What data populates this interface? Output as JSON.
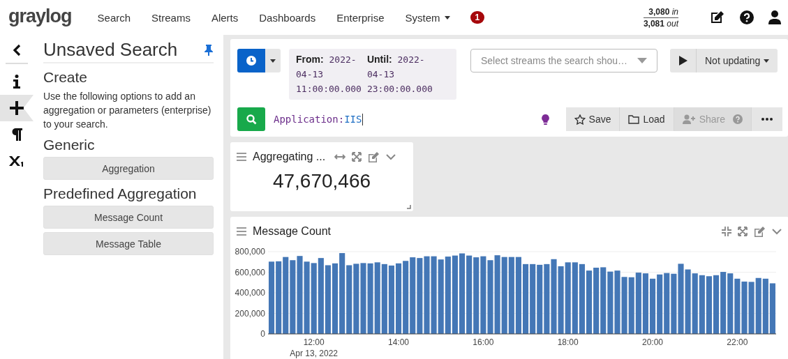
{
  "nav": {
    "logo": "graylog",
    "items": [
      {
        "label": "Search",
        "has_caret": false
      },
      {
        "label": "Streams",
        "has_caret": false
      },
      {
        "label": "Alerts",
        "has_caret": false
      },
      {
        "label": "Dashboards",
        "has_caret": false
      },
      {
        "label": "Enterprise",
        "has_caret": false
      },
      {
        "label": "System",
        "has_caret": true
      }
    ],
    "notification_count": "1",
    "throughput": {
      "in_value": "3,080",
      "in_unit": "in",
      "out_value": "3,081",
      "out_unit": "out"
    }
  },
  "rail": [
    {
      "kind": "back",
      "selected": false
    },
    {
      "kind": "info",
      "selected": false
    },
    {
      "kind": "create",
      "selected": true
    },
    {
      "kind": "pilcrow",
      "selected": false
    },
    {
      "kind": "parameters",
      "selected": false
    }
  ],
  "sidebar": {
    "title": "Unsaved Search",
    "pinned": true,
    "heading": "Create",
    "description": "Use the following options to add an aggregation or parameters (enterprise) to your search.",
    "sections": [
      {
        "title": "Generic",
        "buttons": [
          "Aggregation"
        ]
      },
      {
        "title": "Predefined Aggregation",
        "buttons": [
          "Message Count",
          "Message Table"
        ]
      }
    ]
  },
  "search": {
    "range": [
      {
        "label": "From:",
        "lines": [
          "2022-",
          "04-13",
          "11:00:00.000"
        ]
      },
      {
        "label": "Until:",
        "lines": [
          "2022-",
          "04-13",
          "23:00:00.000"
        ]
      }
    ],
    "streams_placeholder": "Select streams the search shou…",
    "refresh": "Not updating",
    "query_field": "Application:",
    "query_value": "IIS",
    "actions": [
      {
        "kind": "save",
        "label": "Save",
        "disabled": false
      },
      {
        "kind": "load",
        "label": "Load",
        "disabled": false
      },
      {
        "kind": "share",
        "label": "Share",
        "disabled": true
      },
      {
        "kind": "more"
      }
    ]
  },
  "widgets": [
    {
      "kind": "number",
      "title": "Aggregating ...",
      "value": "47,670,466"
    },
    {
      "kind": "chart",
      "title": "Message Count",
      "chart_data": {
        "type": "bar",
        "grid": true,
        "xlim": [
          10.917,
          22.917
        ],
        "x": [
          11,
          11.167,
          11.333,
          11.5,
          11.667,
          11.833,
          12,
          12.167,
          12.333,
          12.5,
          12.667,
          12.833,
          13,
          13.167,
          13.333,
          13.5,
          13.667,
          13.833,
          14,
          14.167,
          14.333,
          14.5,
          14.667,
          14.833,
          15,
          15.167,
          15.333,
          15.5,
          15.667,
          15.833,
          16,
          16.167,
          16.333,
          16.5,
          16.667,
          16.833,
          17,
          17.167,
          17.333,
          17.5,
          17.667,
          17.833,
          18,
          18.167,
          18.333,
          18.5,
          18.667,
          18.833,
          19,
          19.167,
          19.333,
          19.5,
          19.667,
          19.833,
          20,
          20.167,
          20.333,
          20.5,
          20.667,
          20.833,
          21,
          21.167,
          21.333,
          21.5,
          21.667,
          21.833,
          22,
          22.167,
          22.333,
          22.5,
          22.667,
          22.833
        ],
        "series": [
          {
            "color": "#4477b6",
            "values": [
              703000,
              706000,
              748000,
              717000,
              758000,
              703000,
              689000,
              738000,
              668000,
              686000,
              786000,
              668000,
              682000,
              689000,
              686000,
              696000,
              679000,
              665000,
              686000,
              710000,
              745000,
              738000,
              755000,
              755000,
              724000,
              752000,
              762000,
              783000,
              762000,
              745000,
              755000,
              717000,
              765000,
              748000,
              748000,
              748000,
              679000,
              679000,
              672000,
              679000,
              727000,
              658000,
              696000,
              696000,
              679000,
              616000,
              644000,
              648000,
              606000,
              616000,
              554000,
              551000,
              596000,
              589000,
              537000,
              578000,
              592000,
              585000,
              682000,
              627000,
              589000,
              571000,
              561000,
              571000,
              603000,
              589000,
              537000,
              509000,
              506000,
              544000,
              537000,
              492000
            ]
          }
        ],
        "ylim": [
          0,
          800000
        ],
        "yticks": [
          {
            "value": 0,
            "label": "0"
          },
          {
            "value": 200000,
            "label": "200,000"
          },
          {
            "value": 400000,
            "label": "400,000"
          },
          {
            "value": 600000,
            "label": "600,000"
          },
          {
            "value": 800000,
            "label": "800,000"
          }
        ],
        "xticks": [
          {
            "value": 12,
            "label": "12:00"
          },
          {
            "value": 14,
            "label": "14:00"
          },
          {
            "value": 16,
            "label": "16:00"
          },
          {
            "value": 18,
            "label": "18:00"
          },
          {
            "value": 20,
            "label": "20:00"
          },
          {
            "value": 22,
            "label": "22:00"
          }
        ],
        "annotations": [
          "Apr 13, 2022"
        ]
      }
    }
  ]
}
